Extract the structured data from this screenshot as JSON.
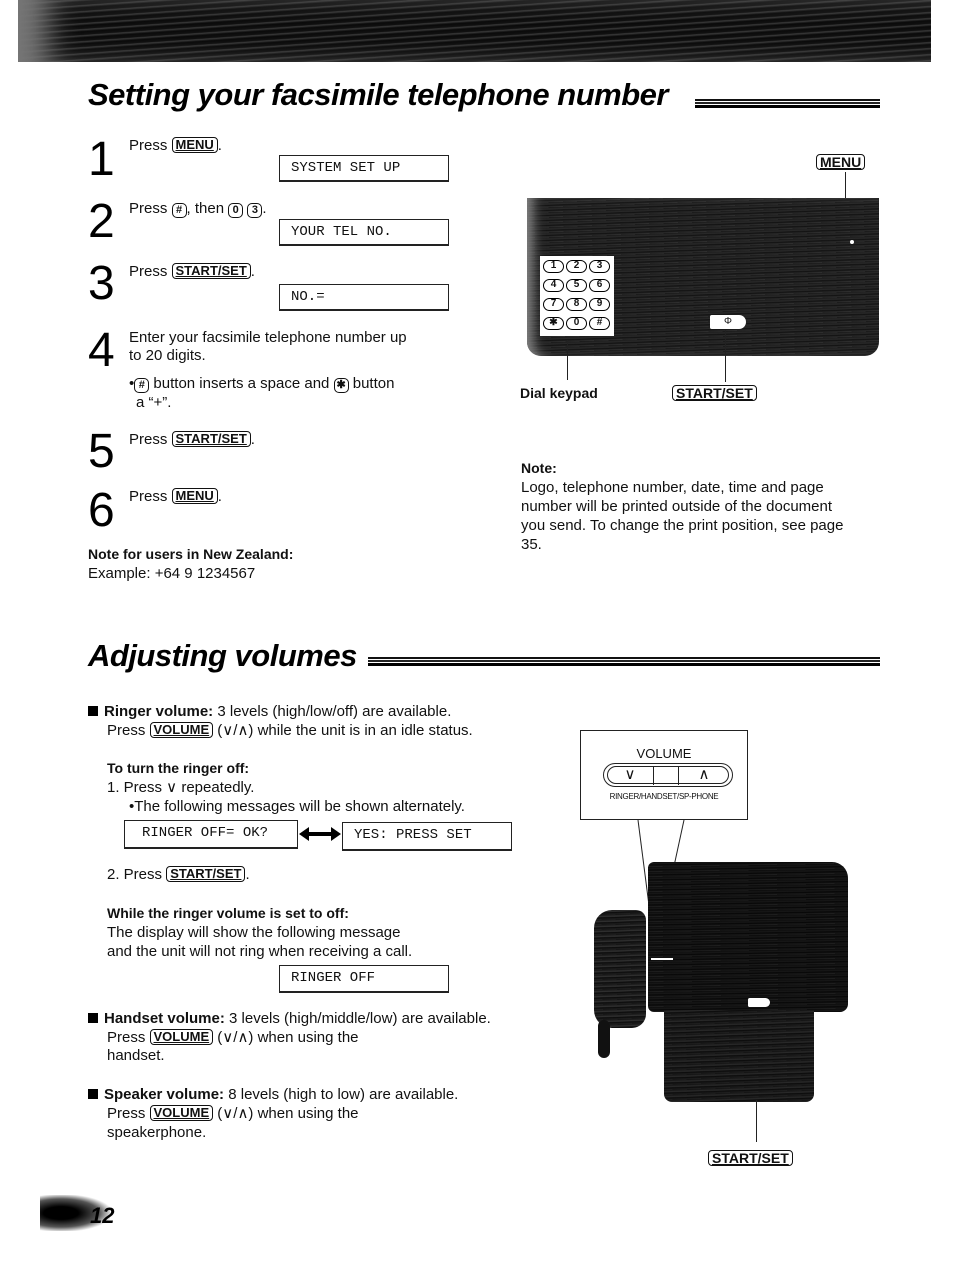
{
  "section1": {
    "title": "Setting your facsimile telephone number",
    "steps": [
      {
        "num": "1",
        "prefix": "Press ",
        "key": "MENU",
        "suffix": ".",
        "display": "SYSTEM SET UP"
      },
      {
        "num": "2",
        "prefix": "Press ",
        "key1": "#",
        "mid": ", then ",
        "key2": "0",
        "key3": "3",
        "suffix": ".",
        "display": "YOUR TEL NO."
      },
      {
        "num": "3",
        "prefix": "Press ",
        "key": "START/SET",
        "suffix": ".",
        "display": "NO.="
      },
      {
        "num": "4",
        "line1": "Enter your facsimile telephone number up",
        "line2": "to 20 digits.",
        "bullet": {
          "key1": "#",
          "mid": " button inserts a space and ",
          "key2": "✱",
          "after": " button",
          "line2": "a “+”."
        }
      },
      {
        "num": "5",
        "prefix": "Press ",
        "key": "START/SET",
        "suffix": "."
      },
      {
        "num": "6",
        "prefix": "Press ",
        "key": "MENU",
        "suffix": "."
      }
    ],
    "nz_note": {
      "heading": "Note for users in New Zealand:",
      "example": "Example: +64 9 1234567"
    },
    "figure": {
      "menu_label": "MENU",
      "dial_keypad_label": "Dial keypad",
      "start_set_label": "START/SET",
      "keypad_keys": [
        "1",
        "2",
        "3",
        "4",
        "5",
        "6",
        "7",
        "8",
        "9",
        "✱",
        "0",
        "#"
      ],
      "start_symbol": "Φ"
    },
    "note": {
      "heading": "Note:",
      "lines": [
        "Logo, telephone number, date, time and page",
        "number will be printed outside of the document",
        "you send. To change the print position, see page",
        "35."
      ]
    }
  },
  "section2": {
    "title": "Adjusting volumes",
    "ringer": {
      "label": "Ringer volume:",
      "desc": " 3 levels (high/low/off) are available.",
      "press": "Press ",
      "key": "VOLUME",
      "after": " (∨/∧) while the unit is in an idle status.",
      "turn_off_heading": "To turn the ringer off:",
      "step1": "1. Press ∨ repeatedly.",
      "step1_bullet": "•The following messages will be shown alternately.",
      "display_a": "RINGER OFF= OK?",
      "display_b": "YES: PRESS SET",
      "step2_prefix": "2. Press ",
      "step2_key": "START/SET",
      "step2_suffix": ".",
      "while_off_heading": "While the ringer volume is set to off:",
      "while_off_line1": "The display will show the following message",
      "while_off_line2": "and the unit will not ring when receiving a call.",
      "display_off": "RINGER OFF"
    },
    "handset": {
      "label": "Handset volume:",
      "desc": " 3 levels (high/middle/low) are available.",
      "press": "Press ",
      "key": "VOLUME",
      "after": " (∨/∧) when using the",
      "line3": "handset."
    },
    "speaker": {
      "label": "Speaker volume:",
      "desc": " 8 levels (high to low) are available.",
      "press": "Press ",
      "key": "VOLUME",
      "after": " (∨/∧) when using the",
      "line3": "speakerphone."
    },
    "figure": {
      "volume_label": "VOLUME",
      "down_symbol": "∨",
      "up_symbol": "∧",
      "sub_label": "RINGER/HANDSET/SP-PHONE",
      "start_set_label": "START/SET"
    }
  },
  "page_number": "12"
}
